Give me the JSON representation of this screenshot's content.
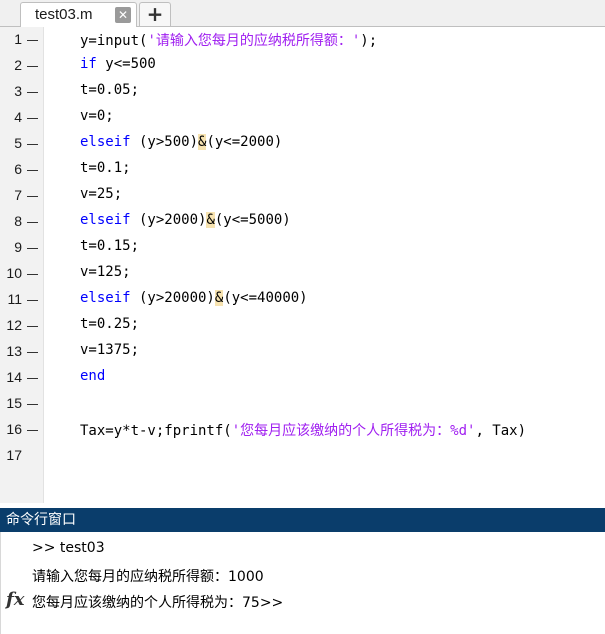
{
  "tabs": [
    {
      "label": "test03.m",
      "active": true
    }
  ],
  "new_tab_label": "+",
  "close_label": "✕",
  "editor": {
    "lines": [
      {
        "n": "1",
        "tokens": [
          {
            "t": "y=input(",
            "c": "plain"
          },
          {
            "t": "'请输入您每月的应纳税所得额：'",
            "c": "str"
          },
          {
            "t": ");",
            "c": "plain"
          }
        ]
      },
      {
        "n": "2",
        "tokens": [
          {
            "t": "if",
            "c": "kw"
          },
          {
            "t": " y<=500",
            "c": "plain"
          }
        ]
      },
      {
        "n": "3",
        "tokens": [
          {
            "t": "t=0.05;",
            "c": "plain"
          }
        ]
      },
      {
        "n": "4",
        "tokens": [
          {
            "t": "v=0;",
            "c": "plain"
          }
        ]
      },
      {
        "n": "5",
        "tokens": [
          {
            "t": "elseif",
            "c": "kw"
          },
          {
            "t": " (y>500)",
            "c": "plain"
          },
          {
            "t": "&",
            "c": "amp"
          },
          {
            "t": "(y<=2000)",
            "c": "plain"
          }
        ]
      },
      {
        "n": "6",
        "tokens": [
          {
            "t": "t=0.1;",
            "c": "plain"
          }
        ]
      },
      {
        "n": "7",
        "tokens": [
          {
            "t": "v=25;",
            "c": "plain"
          }
        ]
      },
      {
        "n": "8",
        "tokens": [
          {
            "t": "elseif",
            "c": "kw"
          },
          {
            "t": " (y>2000)",
            "c": "plain"
          },
          {
            "t": "&",
            "c": "amp"
          },
          {
            "t": "(y<=5000)",
            "c": "plain"
          }
        ]
      },
      {
        "n": "9",
        "tokens": [
          {
            "t": "t=0.15;",
            "c": "plain"
          }
        ]
      },
      {
        "n": "10",
        "tokens": [
          {
            "t": "v=125;",
            "c": "plain"
          }
        ]
      },
      {
        "n": "11",
        "tokens": [
          {
            "t": "elseif",
            "c": "kw"
          },
          {
            "t": " (y>20000)",
            "c": "plain"
          },
          {
            "t": "&",
            "c": "amp"
          },
          {
            "t": "(y<=40000)",
            "c": "plain"
          }
        ]
      },
      {
        "n": "12",
        "tokens": [
          {
            "t": "t=0.25;",
            "c": "plain"
          }
        ]
      },
      {
        "n": "13",
        "tokens": [
          {
            "t": "v=1375;",
            "c": "plain"
          }
        ]
      },
      {
        "n": "14",
        "tokens": [
          {
            "t": "end",
            "c": "kw"
          }
        ]
      },
      {
        "n": "15",
        "tokens": []
      },
      {
        "n": "16",
        "tokens": [
          {
            "t": "Tax=y*t-v;fprintf(",
            "c": "plain"
          },
          {
            "t": "'您每月应该缴纳的个人所得税为：%d'",
            "c": "str"
          },
          {
            "t": ", Tax)",
            "c": "plain"
          }
        ]
      },
      {
        "n": "17",
        "tokens": [],
        "no_dash": true
      }
    ]
  },
  "command_window": {
    "title": "命令行窗口",
    "lines": [
      ">> test03",
      "请输入您每月的应纳税所得额：1000",
      "您每月应该缴纳的个人所得税为：75>>"
    ],
    "fx_label": "fx"
  },
  "colors": {
    "keyword": "#0000ff",
    "string": "#a020f0",
    "highlight": "#f7e3b0",
    "command_title_bg": "#0a3d6b"
  }
}
